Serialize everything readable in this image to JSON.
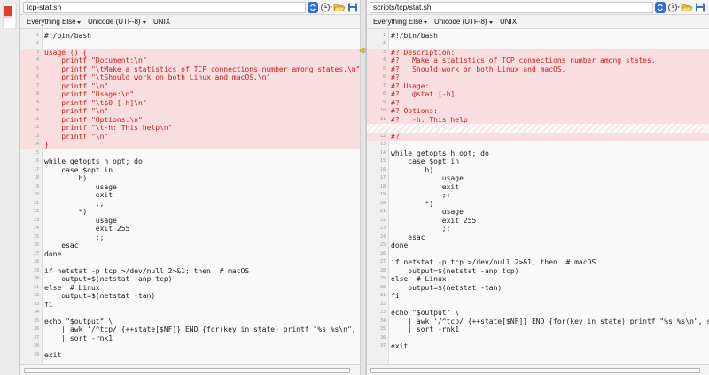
{
  "left": {
    "path": "tcp-stat.sh",
    "filter": "Everything Else",
    "encoding": "Unicode (UTF-8)",
    "line_endings": "UNIX",
    "lines": [
      {
        "n": "1",
        "t": "#!/bin/bash",
        "s": "n"
      },
      {
        "n": "2",
        "t": "",
        "s": "n"
      },
      {
        "n": "3",
        "t": "usage () {",
        "s": "d"
      },
      {
        "n": "4",
        "t": "    printf \"Document:\\n\"",
        "s": "d"
      },
      {
        "n": "5",
        "t": "    printf \"\\tMake a statistics of TCP connections number among states.\\n\"",
        "s": "d"
      },
      {
        "n": "6",
        "t": "    printf \"\\tShould work on both Linux and macOS.\\n\"",
        "s": "d"
      },
      {
        "n": "7",
        "t": "    printf \"\\n\"",
        "s": "d"
      },
      {
        "n": "8",
        "t": "    printf \"Usage:\\n\"",
        "s": "d"
      },
      {
        "n": "9",
        "t": "    printf \"\\t$0 [-h]\\n\"",
        "s": "d"
      },
      {
        "n": "10",
        "t": "    printf \"\\n\"",
        "s": "d"
      },
      {
        "n": "11",
        "t": "    printf \"Options:\\n\"",
        "s": "d"
      },
      {
        "n": "12",
        "t": "    printf \"\\t-h: This help\\n\"",
        "s": "d"
      },
      {
        "n": "13",
        "t": "    printf \"\\n\"",
        "s": "d"
      },
      {
        "n": "14",
        "t": "}",
        "s": "d"
      },
      {
        "n": "15",
        "t": "",
        "s": "n"
      },
      {
        "n": "16",
        "t": "while getopts h opt; do",
        "s": "n"
      },
      {
        "n": "17",
        "t": "    case $opt in",
        "s": "n"
      },
      {
        "n": "18",
        "t": "        h)",
        "s": "n"
      },
      {
        "n": "19",
        "t": "            usage",
        "s": "n"
      },
      {
        "n": "20",
        "t": "            exit",
        "s": "n"
      },
      {
        "n": "21",
        "t": "            ;;",
        "s": "n"
      },
      {
        "n": "22",
        "t": "        *)",
        "s": "n"
      },
      {
        "n": "23",
        "t": "            usage",
        "s": "n"
      },
      {
        "n": "24",
        "t": "            exit 255",
        "s": "n"
      },
      {
        "n": "25",
        "t": "            ;;",
        "s": "n"
      },
      {
        "n": "26",
        "t": "    esac",
        "s": "n"
      },
      {
        "n": "27",
        "t": "done",
        "s": "n"
      },
      {
        "n": "28",
        "t": "",
        "s": "n"
      },
      {
        "n": "29",
        "t": "if netstat -p tcp >/dev/null 2>&1; then  # macOS",
        "s": "n"
      },
      {
        "n": "30",
        "t": "    output=$(netstat -anp tcp)",
        "s": "n"
      },
      {
        "n": "31",
        "t": "else  # Linux",
        "s": "n"
      },
      {
        "n": "32",
        "t": "    output=$(netstat -tan)",
        "s": "n"
      },
      {
        "n": "33",
        "t": "fi",
        "s": "n"
      },
      {
        "n": "34",
        "t": "",
        "s": "n"
      },
      {
        "n": "35",
        "t": "echo \"$output\" \\",
        "s": "n"
      },
      {
        "n": "36",
        "t": "    | awk '/^tcp/ {++state[$NF]} END {for(key in state) printf \"%s %s\\n\", sta",
        "s": "n"
      },
      {
        "n": "37",
        "t": "    | sort -rnk1",
        "s": "n"
      },
      {
        "n": "38",
        "t": "",
        "s": "n"
      },
      {
        "n": "39",
        "t": "exit",
        "s": "n"
      }
    ]
  },
  "right": {
    "path": "scripts/tcp/stat.sh",
    "filter": "Everything Else",
    "encoding": "Unicode (UTF-8)",
    "line_endings": "UNIX",
    "lines": [
      {
        "n": "1",
        "t": "#!/bin/bash",
        "s": "n"
      },
      {
        "n": "2",
        "t": "",
        "s": "n"
      },
      {
        "n": "3",
        "t": "#? Description:",
        "s": "d"
      },
      {
        "n": "4",
        "t": "#?   Make a statistics of TCP connections number among states.",
        "s": "d"
      },
      {
        "n": "5",
        "t": "#?   Should work on both Linux and macOS.",
        "s": "d"
      },
      {
        "n": "6",
        "t": "#?",
        "s": "d"
      },
      {
        "n": "7",
        "t": "#? Usage:",
        "s": "d"
      },
      {
        "n": "8",
        "t": "#?   @stat [-h]",
        "s": "d"
      },
      {
        "n": "9",
        "t": "#?",
        "s": "d"
      },
      {
        "n": "10",
        "t": "#? Options:",
        "s": "d"
      },
      {
        "n": "11",
        "t": "#?   -h: This help",
        "s": "d"
      },
      {
        "n": "",
        "t": "",
        "s": "f"
      },
      {
        "n": "12",
        "t": "#?",
        "s": "d"
      },
      {
        "n": "13",
        "t": "",
        "s": "n"
      },
      {
        "n": "14",
        "t": "while getopts h opt; do",
        "s": "n"
      },
      {
        "n": "15",
        "t": "    case $opt in",
        "s": "n"
      },
      {
        "n": "16",
        "t": "        h)",
        "s": "n"
      },
      {
        "n": "17",
        "t": "            usage",
        "s": "n"
      },
      {
        "n": "18",
        "t": "            exit",
        "s": "n"
      },
      {
        "n": "19",
        "t": "            ;;",
        "s": "n"
      },
      {
        "n": "20",
        "t": "        *)",
        "s": "n"
      },
      {
        "n": "21",
        "t": "            usage",
        "s": "n"
      },
      {
        "n": "22",
        "t": "            exit 255",
        "s": "n"
      },
      {
        "n": "23",
        "t": "            ;;",
        "s": "n"
      },
      {
        "n": "24",
        "t": "    esac",
        "s": "n"
      },
      {
        "n": "25",
        "t": "done",
        "s": "n"
      },
      {
        "n": "26",
        "t": "",
        "s": "n"
      },
      {
        "n": "27",
        "t": "if netstat -p tcp >/dev/null 2>&1; then  # macOS",
        "s": "n"
      },
      {
        "n": "28",
        "t": "    output=$(netstat -anp tcp)",
        "s": "n"
      },
      {
        "n": "29",
        "t": "else  # Linux",
        "s": "n"
      },
      {
        "n": "30",
        "t": "    output=$(netstat -tan)",
        "s": "n"
      },
      {
        "n": "31",
        "t": "fi",
        "s": "n"
      },
      {
        "n": "32",
        "t": "",
        "s": "n"
      },
      {
        "n": "33",
        "t": "echo \"$output\" \\",
        "s": "n"
      },
      {
        "n": "34",
        "t": "    | awk '/^tcp/ {++state[$NF]} END {for(key in state) printf \"%s %s\\n\", sta",
        "s": "n"
      },
      {
        "n": "35",
        "t": "    | sort -rnk1",
        "s": "n"
      },
      {
        "n": "36",
        "t": "",
        "s": "n"
      },
      {
        "n": "37",
        "t": "exit",
        "s": "n"
      }
    ]
  },
  "icons": {
    "combo": "chevron-updown-icon",
    "history": "clock-history-icon",
    "open": "folder-open-icon",
    "save": "floppy-disk-icon",
    "current_diff": "current-diff-arrow-icon",
    "navigator": "diff-navigator-marker-icon"
  },
  "colors": {
    "diff_bg": "#f8dede",
    "diff_text": "#c42222",
    "accent": "#2f6fd6"
  }
}
